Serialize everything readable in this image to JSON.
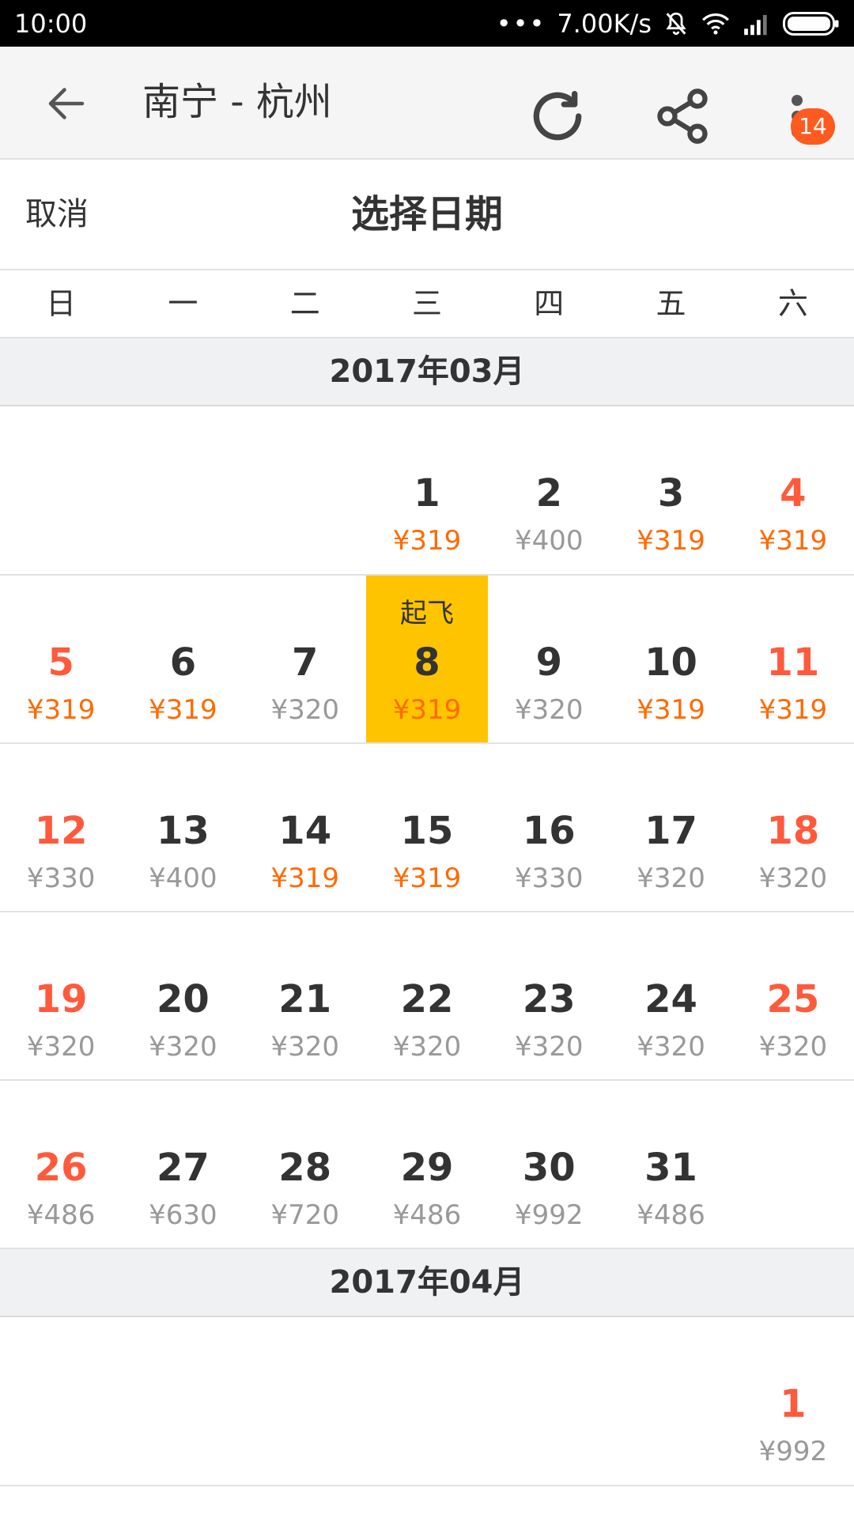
{
  "status_bar": {
    "time": "10:00",
    "speed": "7.00K/s"
  },
  "app_bar": {
    "title": "南宁 - 杭州",
    "badge": "14"
  },
  "picker": {
    "cancel_label": "取消",
    "title": "选择日期"
  },
  "weekdays": [
    "日",
    "一",
    "二",
    "三",
    "四",
    "五",
    "六"
  ],
  "months": [
    {
      "label": "2017年03月",
      "weeks": [
        [
          {
            "day": "",
            "price": ""
          },
          {
            "day": "",
            "price": ""
          },
          {
            "day": "",
            "price": ""
          },
          {
            "day": "1",
            "price": "¥319",
            "hot": true
          },
          {
            "day": "2",
            "price": "¥400"
          },
          {
            "day": "3",
            "price": "¥319",
            "hot": true
          },
          {
            "day": "4",
            "price": "¥319",
            "hot": true,
            "weekend": true
          }
        ],
        [
          {
            "day": "5",
            "price": "¥319",
            "hot": true,
            "weekend": true
          },
          {
            "day": "6",
            "price": "¥319",
            "hot": true
          },
          {
            "day": "7",
            "price": "¥320"
          },
          {
            "day": "8",
            "price": "¥319",
            "hot": true,
            "selected": true,
            "tag": "起飞"
          },
          {
            "day": "9",
            "price": "¥320"
          },
          {
            "day": "10",
            "price": "¥319",
            "hot": true
          },
          {
            "day": "11",
            "price": "¥319",
            "hot": true,
            "weekend": true
          }
        ],
        [
          {
            "day": "12",
            "price": "¥330",
            "weekend": true
          },
          {
            "day": "13",
            "price": "¥400"
          },
          {
            "day": "14",
            "price": "¥319",
            "hot": true
          },
          {
            "day": "15",
            "price": "¥319",
            "hot": true
          },
          {
            "day": "16",
            "price": "¥330"
          },
          {
            "day": "17",
            "price": "¥320"
          },
          {
            "day": "18",
            "price": "¥320",
            "weekend": true
          }
        ],
        [
          {
            "day": "19",
            "price": "¥320",
            "weekend": true
          },
          {
            "day": "20",
            "price": "¥320"
          },
          {
            "day": "21",
            "price": "¥320"
          },
          {
            "day": "22",
            "price": "¥320"
          },
          {
            "day": "23",
            "price": "¥320"
          },
          {
            "day": "24",
            "price": "¥320"
          },
          {
            "day": "25",
            "price": "¥320",
            "weekend": true
          }
        ],
        [
          {
            "day": "26",
            "price": "¥486",
            "weekend": true
          },
          {
            "day": "27",
            "price": "¥630"
          },
          {
            "day": "28",
            "price": "¥720"
          },
          {
            "day": "29",
            "price": "¥486"
          },
          {
            "day": "30",
            "price": "¥992"
          },
          {
            "day": "31",
            "price": "¥486"
          },
          {
            "day": "",
            "price": ""
          }
        ]
      ]
    },
    {
      "label": "2017年04月",
      "weeks": [
        [
          {
            "day": "",
            "price": ""
          },
          {
            "day": "",
            "price": ""
          },
          {
            "day": "",
            "price": ""
          },
          {
            "day": "",
            "price": ""
          },
          {
            "day": "",
            "price": ""
          },
          {
            "day": "",
            "price": ""
          },
          {
            "day": "1",
            "price": "¥992",
            "weekend": true
          }
        ]
      ]
    }
  ],
  "colors": {
    "selected_bg": "#ffc400",
    "weekend_day": "#ff5a3c",
    "low_price": "#ff6a00",
    "normal_price": "#999999",
    "badge": "#ff5a1f"
  },
  "icons": {
    "back": "arrow-left-icon",
    "refresh": "refresh-icon",
    "share": "share-icon",
    "more": "more-vertical-icon"
  }
}
